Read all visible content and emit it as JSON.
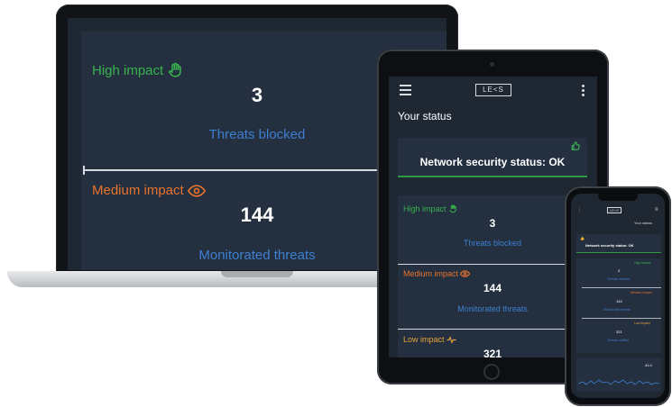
{
  "laptop": {
    "high": {
      "label": "High impact",
      "value": "3",
      "sub": "Threats blocked",
      "color": "#37b24d"
    },
    "medium": {
      "label": "Medium impact",
      "value": "144",
      "sub": "Monitorated threats",
      "color": "#e8732c"
    }
  },
  "tablet": {
    "logo": "LE<S",
    "title": "Your status",
    "status": "Network security status: OK",
    "high": {
      "label": "High impact",
      "value": "3",
      "sub": "Threats blocked"
    },
    "medium": {
      "label": "Medium impact",
      "value": "144",
      "sub": "Monitorated threats"
    },
    "low": {
      "label": "Low impact",
      "value": "321"
    }
  },
  "phone": {
    "logo": "LE<S",
    "title": "Your status",
    "status": "Network security status: OK",
    "high": {
      "label": "High impact",
      "value": "3",
      "sub": "Threats blocked"
    },
    "medium": {
      "label": "Medium impact",
      "value": "144",
      "sub": "Monitorated threats"
    },
    "low": {
      "label": "Low impact",
      "value": "321",
      "sub": "Threats notified"
    },
    "metric": "41.0"
  },
  "colors": {
    "high": "#37b24d",
    "medium": "#e8732c",
    "low": "#e8a33c",
    "sub": "#3d7fd1"
  },
  "icons": {
    "high": "hand-icon",
    "medium": "eye-icon",
    "low": "pulse-icon",
    "status": "thumbs-up-icon"
  }
}
